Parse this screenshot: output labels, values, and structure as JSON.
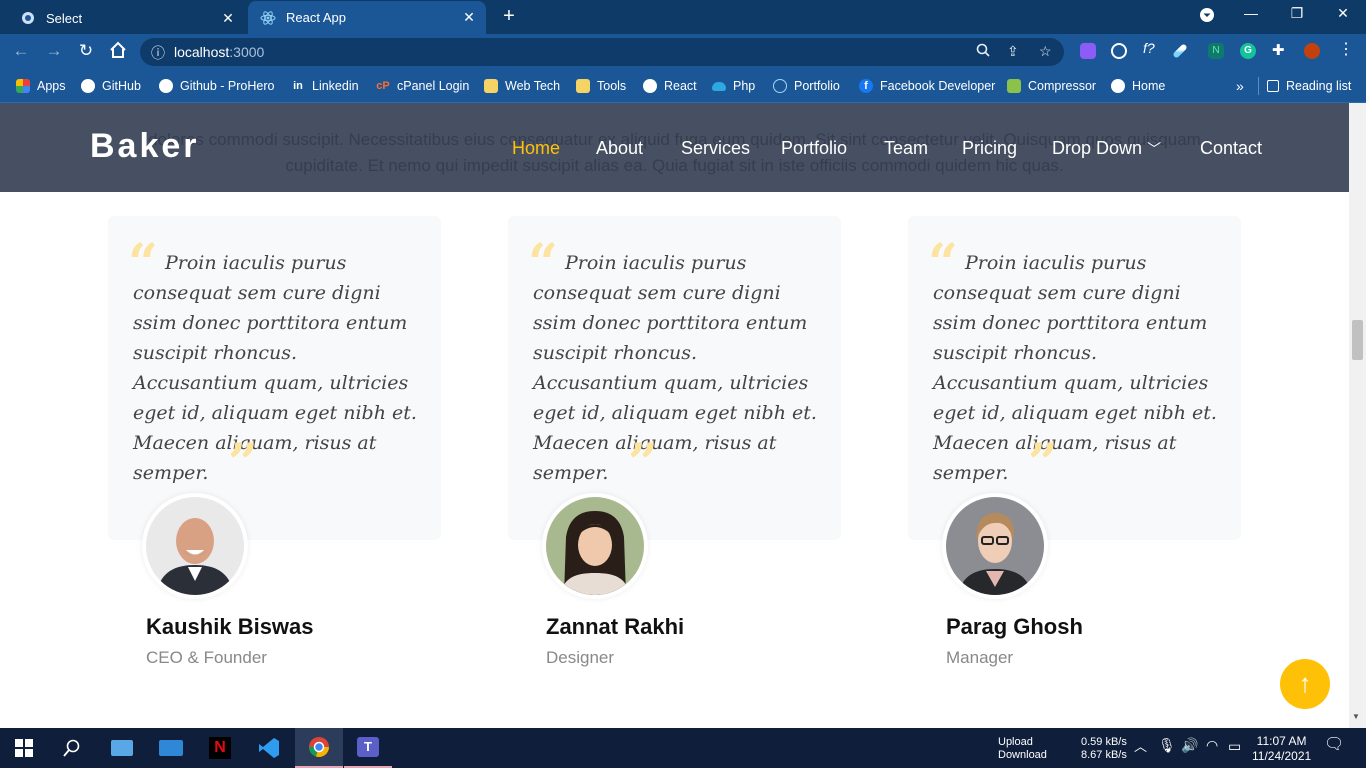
{
  "browser": {
    "tabs": [
      {
        "title": "Select"
      },
      {
        "title": "React App"
      }
    ],
    "url_host": "localhost",
    "url_port": ":3000",
    "bookmarks": [
      "Apps",
      "GitHub",
      "Github - ProHero",
      "Linkedin",
      "cPanel Login",
      "Web Tech",
      "Tools",
      "React",
      "Php",
      "Portfolio",
      "Facebook Developer",
      "Compressor",
      "Home"
    ],
    "overflow": "»",
    "reading_list": "Reading list"
  },
  "site": {
    "logo": "Baker",
    "ghost_text_1": "dolores commodi suscipit. Necessitatibus eius consequatur ex aliquid fuga eum quidem. Sit sint consectetur velit. Quisquam quos quisquam",
    "ghost_text_2": "cupiditate. Et nemo qui impedit suscipit alias ea. Quia fugiat sit in iste officiis commodi quidem hic quas.",
    "nav": [
      "Home",
      "About",
      "Services",
      "Portfolio",
      "Team",
      "Pricing",
      "Drop Down",
      "Contact"
    ],
    "active_nav": "Home",
    "testimonials": [
      {
        "quote": "Proin iaculis purus consequat sem cure digni ssim donec porttitora entum suscipit rhoncus. Accusantium quam, ultricies eget id, aliquam eget nibh et. Maecen aliquam, risus at semper.",
        "name": "Kaushik Biswas",
        "role": "CEO & Founder"
      },
      {
        "quote": "Proin iaculis purus consequat sem cure digni ssim donec porttitora entum suscipit rhoncus. Accusantium quam, ultricies eget id, aliquam eget nibh et. Maecen aliquam, risus at semper.",
        "name": "Zannat Rakhi",
        "role": "Designer"
      },
      {
        "quote": "Proin iaculis purus consequat sem cure digni ssim donec porttitora entum suscipit rhoncus. Accusantium quam, ultricies eget id, aliquam eget nibh et. Maecen aliquam, risus at semper.",
        "name": "Parag Ghosh",
        "role": "Manager"
      }
    ],
    "accent_color": "#ffc107"
  },
  "taskbar": {
    "upload_label": "Upload",
    "download_label": "Download",
    "upload_speed": "0.59 kB/s",
    "download_speed": "8.67 kB/s",
    "time": "11:07 AM",
    "date": "11/24/2021"
  }
}
